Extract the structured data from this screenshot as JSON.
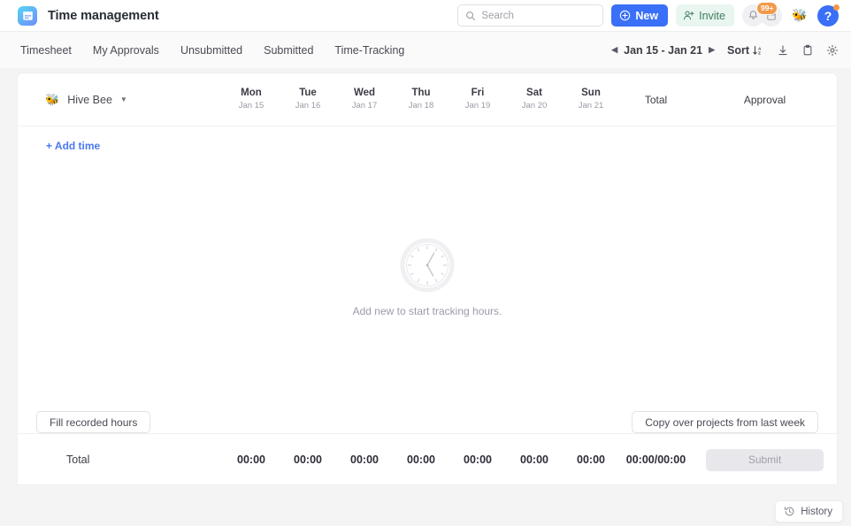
{
  "header": {
    "app_title": "Time management",
    "logo_icon": "calendar-app-icon",
    "search": {
      "placeholder": "Search",
      "value": "",
      "icon": "search-icon"
    },
    "new_button": {
      "label": "New",
      "icon": "plus-circle-icon",
      "color": "#3a6ff7"
    },
    "invite_button": {
      "label": "Invite",
      "icon": "person-add-icon",
      "color": "#e9f6ef"
    },
    "notifications": {
      "icon": "bell-icon",
      "badge": "99+",
      "badge_color": "#f2994a"
    },
    "calendar_icon": "calendar-icon",
    "avatar": {
      "icon": "bee-avatar-icon",
      "glyph": "🐝"
    },
    "help_button": {
      "label": "?",
      "icon": "question-mark-icon",
      "has_dot": true
    }
  },
  "nav": {
    "tabs": [
      {
        "label": "Timesheet",
        "active": true
      },
      {
        "label": "My Approvals",
        "active": false
      },
      {
        "label": "Unsubmitted",
        "active": false
      },
      {
        "label": "Submitted",
        "active": false
      },
      {
        "label": "Time-Tracking",
        "active": false
      }
    ],
    "week_range": "Jan 15 - Jan 21",
    "prev_icon": "chevron-left-icon",
    "next_icon": "chevron-right-icon",
    "sort": {
      "label": "Sort",
      "icon": "sort-az-icon"
    },
    "download_icon": "download-icon",
    "clipboard_icon": "clipboard-icon",
    "settings_icon": "gear-icon"
  },
  "sheet": {
    "assignee": {
      "name": "Hive Bee",
      "icon": "bee-icon",
      "glyph": "🐝",
      "caret": "chevron-down-icon"
    },
    "days": [
      {
        "name": "Mon",
        "date": "Jan 15"
      },
      {
        "name": "Tue",
        "date": "Jan 16"
      },
      {
        "name": "Wed",
        "date": "Jan 17"
      },
      {
        "name": "Thu",
        "date": "Jan 18"
      },
      {
        "name": "Fri",
        "date": "Jan 19"
      },
      {
        "name": "Sat",
        "date": "Jan 20"
      },
      {
        "name": "Sun",
        "date": "Jan 21"
      }
    ],
    "total_header": "Total",
    "approval_header": "Approval",
    "add_time_label": "+ Add time",
    "empty_state": {
      "icon": "clock-icon",
      "message": "Add new to start tracking hours."
    },
    "fill_recorded_label": "Fill recorded hours",
    "copy_projects_label": "Copy over projects from last week",
    "totals": {
      "label": "Total",
      "day_values": [
        "00:00",
        "00:00",
        "00:00",
        "00:00",
        "00:00",
        "00:00",
        "00:00"
      ],
      "grand_total": "00:00/00:00",
      "submit_label": "Submit"
    }
  },
  "history": {
    "label": "History",
    "icon": "history-icon"
  }
}
